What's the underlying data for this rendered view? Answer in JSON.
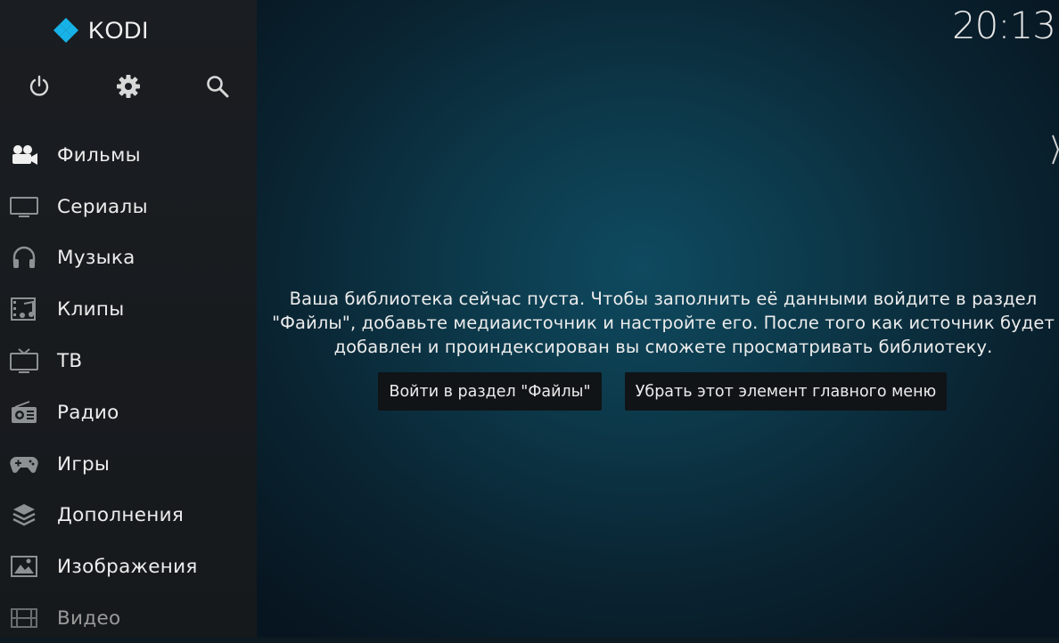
{
  "app": {
    "name": "KODI"
  },
  "clock": {
    "time": "20:13"
  },
  "top_buttons": [
    {
      "name": "power-icon"
    },
    {
      "name": "gear-icon"
    },
    {
      "name": "search-icon"
    }
  ],
  "sidebar": {
    "items": [
      {
        "label": "Фильмы",
        "icon": "camera-icon"
      },
      {
        "label": "Сериалы",
        "icon": "tv-icon"
      },
      {
        "label": "Музыка",
        "icon": "headphones-icon"
      },
      {
        "label": "Клипы",
        "icon": "music-video-icon"
      },
      {
        "label": "ТВ",
        "icon": "tv-antenna-icon"
      },
      {
        "label": "Радио",
        "icon": "radio-icon"
      },
      {
        "label": "Игры",
        "icon": "gamepad-icon"
      },
      {
        "label": "Дополнения",
        "icon": "addons-icon"
      },
      {
        "label": "Изображения",
        "icon": "image-icon"
      },
      {
        "label": "Видео",
        "icon": "film-icon"
      }
    ]
  },
  "main": {
    "message": "Ваша библиотека сейчас пуста. Чтобы заполнить её данными войдите в раздел \"Файлы\", добавьте медиаисточник и настройте его. После того как источник будет добавлен и проиндексирован вы сможете просматривать библиотеку.",
    "buttons": {
      "enter_files": "Войти в раздел \"Файлы\"",
      "remove_item": "Убрать этот элемент главного меню"
    }
  }
}
